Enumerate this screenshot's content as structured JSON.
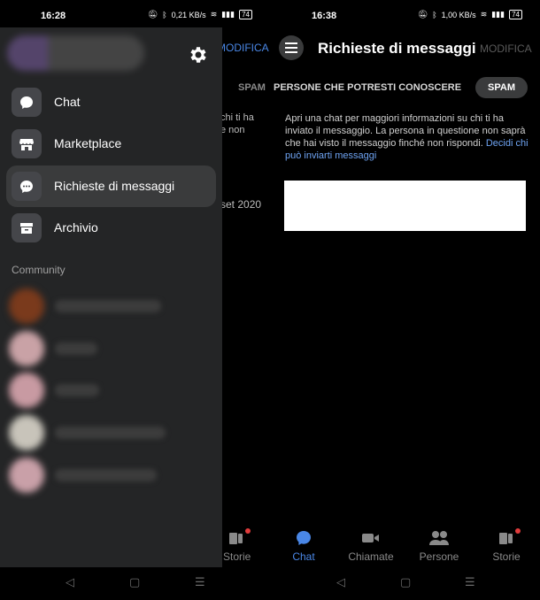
{
  "left": {
    "status": {
      "time": "16:28",
      "net": "0,21 KB/s",
      "battery": "74"
    },
    "background": {
      "modifica": "MODIFICA",
      "spam": "SPAM",
      "snippet_1": "chi ti ha",
      "snippet_2": "e non",
      "date": "set 2020"
    },
    "drawer": {
      "menu": [
        {
          "label": "Chat",
          "icon": "chat-bubble-icon"
        },
        {
          "label": "Marketplace",
          "icon": "store-icon"
        },
        {
          "label": "Richieste di messaggi",
          "icon": "message-request-icon"
        },
        {
          "label": "Archivio",
          "icon": "archive-icon"
        }
      ],
      "community_title": "Community"
    },
    "bottom": {
      "storie": "Storie"
    }
  },
  "right": {
    "status": {
      "time": "16:38",
      "net": "1,00 KB/s",
      "battery": "74"
    },
    "header": {
      "title": "Richieste di messaggi",
      "edit": "MODIFICA"
    },
    "tabs": {
      "people": "PERSONE CHE POTRESTI CONOSCERE",
      "spam": "SPAM"
    },
    "info": {
      "text": "Apri una chat per maggiori informazioni su chi ti ha inviato il messaggio. La persona in questione non saprà che hai visto il messaggio finché non rispondi.",
      "link": "Decidi chi può inviarti messaggi"
    },
    "tabbar": [
      {
        "label": "Chat",
        "icon": "chat-bubble-icon",
        "active": true
      },
      {
        "label": "Chiamate",
        "icon": "video-camera-icon"
      },
      {
        "label": "Persone",
        "icon": "people-icon"
      },
      {
        "label": "Storie",
        "icon": "stories-icon"
      }
    ]
  },
  "navbar": {
    "back": "◁",
    "home": "▢",
    "menu": "☰"
  },
  "colors": {
    "accent": "#4a87e6",
    "drawer": "#242526",
    "badge": "#e23c3c"
  }
}
